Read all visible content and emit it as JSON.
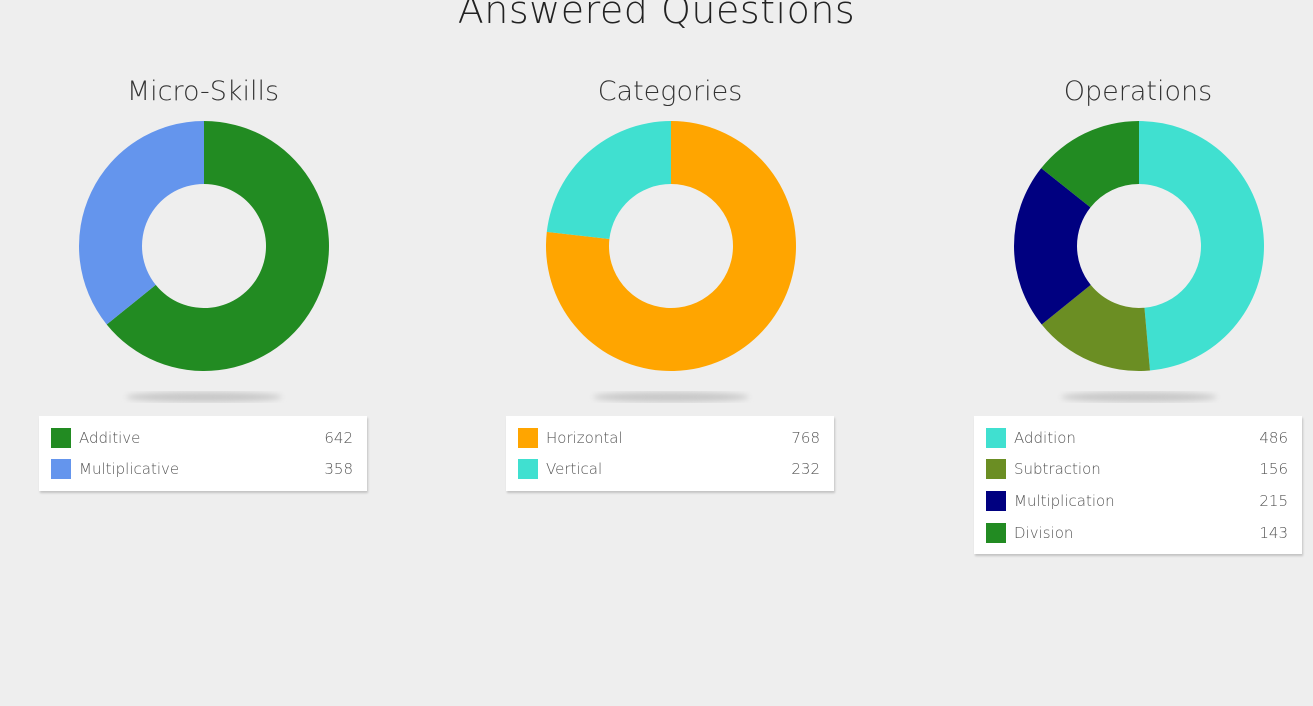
{
  "page": {
    "title": "Answered Questions"
  },
  "chart_data": [
    {
      "type": "pie",
      "variant": "donut",
      "title": "Micro-Skills",
      "categories": [
        "Additive",
        "Multiplicative"
      ],
      "values": [
        642,
        358
      ],
      "colors": [
        "#228b22",
        "#6495ed"
      ]
    },
    {
      "type": "pie",
      "variant": "donut",
      "title": "Categories",
      "categories": [
        "Horizontal",
        "Vertical"
      ],
      "values": [
        768,
        232
      ],
      "colors": [
        "#ffa500",
        "#40e0d0"
      ]
    },
    {
      "type": "pie",
      "variant": "donut",
      "title": "Operations",
      "categories": [
        "Addition",
        "Subtraction",
        "Multiplication",
        "Division"
      ],
      "values": [
        486,
        156,
        215,
        143
      ],
      "colors": [
        "#40e0d0",
        "#6b8e23",
        "#000080",
        "#228b22"
      ]
    }
  ]
}
